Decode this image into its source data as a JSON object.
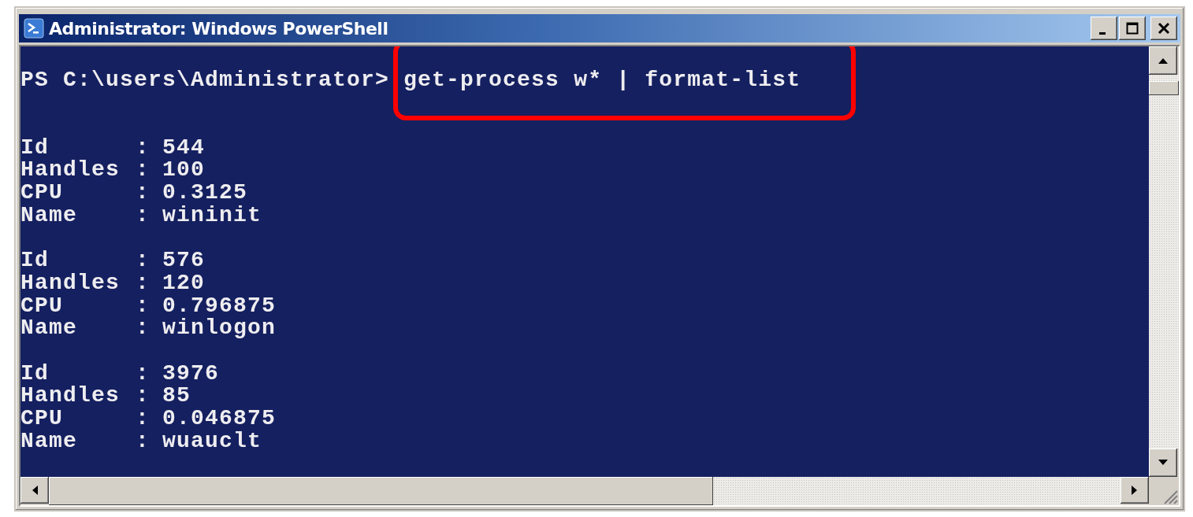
{
  "window": {
    "title": "Administrator: Windows PowerShell"
  },
  "console": {
    "prompt": "PS C:\\users\\Administrator>",
    "command": "get-process w* | format-list",
    "command_highlighted": true,
    "records": [
      {
        "fields": [
          {
            "label": "Id",
            "separator": ":",
            "value": "544"
          },
          {
            "label": "Handles",
            "separator": ":",
            "value": "100"
          },
          {
            "label": "CPU",
            "separator": ":",
            "value": "0.3125"
          },
          {
            "label": "Name",
            "separator": ":",
            "value": "wininit"
          }
        ]
      },
      {
        "fields": [
          {
            "label": "Id",
            "separator": ":",
            "value": "576"
          },
          {
            "label": "Handles",
            "separator": ":",
            "value": "120"
          },
          {
            "label": "CPU",
            "separator": ":",
            "value": "0.796875"
          },
          {
            "label": "Name",
            "separator": ":",
            "value": "winlogon"
          }
        ]
      },
      {
        "fields": [
          {
            "label": "Id",
            "separator": ":",
            "value": "3976"
          },
          {
            "label": "Handles",
            "separator": ":",
            "value": "85"
          },
          {
            "label": "CPU",
            "separator": ":",
            "value": "0.046875"
          },
          {
            "label": "Name",
            "separator": ":",
            "value": "wuauclt"
          }
        ]
      }
    ]
  }
}
